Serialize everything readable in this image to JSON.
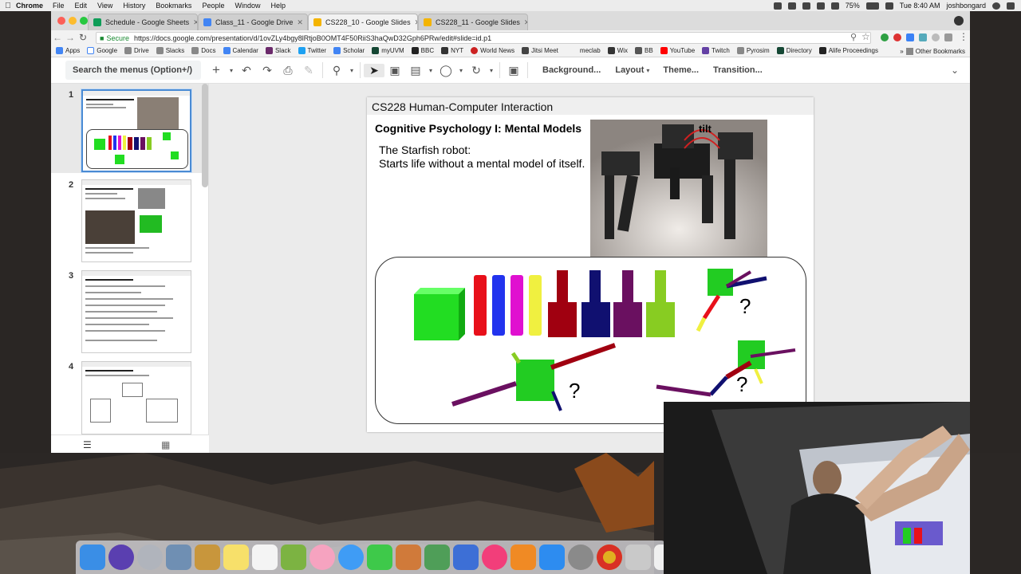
{
  "menubar": {
    "app_name": "Chrome",
    "menus": [
      "File",
      "Edit",
      "View",
      "History",
      "Bookmarks",
      "People",
      "Window",
      "Help"
    ],
    "battery": "75%",
    "clock": "Tue 8:40 AM",
    "user": "joshbongard"
  },
  "browser": {
    "tabs": [
      {
        "title": "Schedule - Google Sheets",
        "color": "#0f9d58",
        "active": false
      },
      {
        "title": "Class_11 - Google Drive",
        "color": "#4285f4",
        "active": false
      },
      {
        "title": "CS228_10 - Google Slides",
        "color": "#f4b400",
        "active": true
      },
      {
        "title": "CS228_11 - Google Slides",
        "color": "#f4b400",
        "active": false
      }
    ],
    "secure_label": "Secure",
    "url": "https://docs.google.com/presentation/d/1ovZLy4bgy8lRtjoB0OMT4F50RiiS3haQwD32Gph6PRw/edit#slide=id.p1",
    "bookmarks": [
      "Apps",
      "Google",
      "Drive",
      "Slacks",
      "Docs",
      "Calendar",
      "Slack",
      "Twitter",
      "Scholar",
      "myUVM",
      "BBC",
      "NYT",
      "World News",
      "Jitsi Meet",
      "meclab",
      "Wix",
      "BB",
      "YouTube",
      "Twitch",
      "Pyrosim",
      "Directory",
      "Alife Proceedings"
    ],
    "other_bookmarks": "Other Bookmarks"
  },
  "slides_toolbar": {
    "search_placeholder": "Search the menus (Option+/)",
    "background": "Background...",
    "layout": "Layout",
    "theme": "Theme...",
    "transition": "Transition..."
  },
  "filmstrip": {
    "slide_numbers": [
      "1",
      "2",
      "3",
      "4"
    ],
    "selected": "1"
  },
  "slide": {
    "header": "CS228 Human-Computer Interaction",
    "title": "Cognitive Psychology I: Mental Models",
    "body_line1": "The Starfish robot:",
    "body_line2": "Starts life without a mental model of itself.",
    "photo_label": "tilt",
    "question_marks": [
      "?",
      "?",
      "?",
      "?"
    ]
  },
  "colors": {
    "accent": "#4a8bd4",
    "green_cube": "#22dd22",
    "cylinders": [
      "#e8101a",
      "#2233ee",
      "#e010d0",
      "#f0f040",
      "#a00010",
      "#101070",
      "#6a1060",
      "#88cc22"
    ]
  }
}
